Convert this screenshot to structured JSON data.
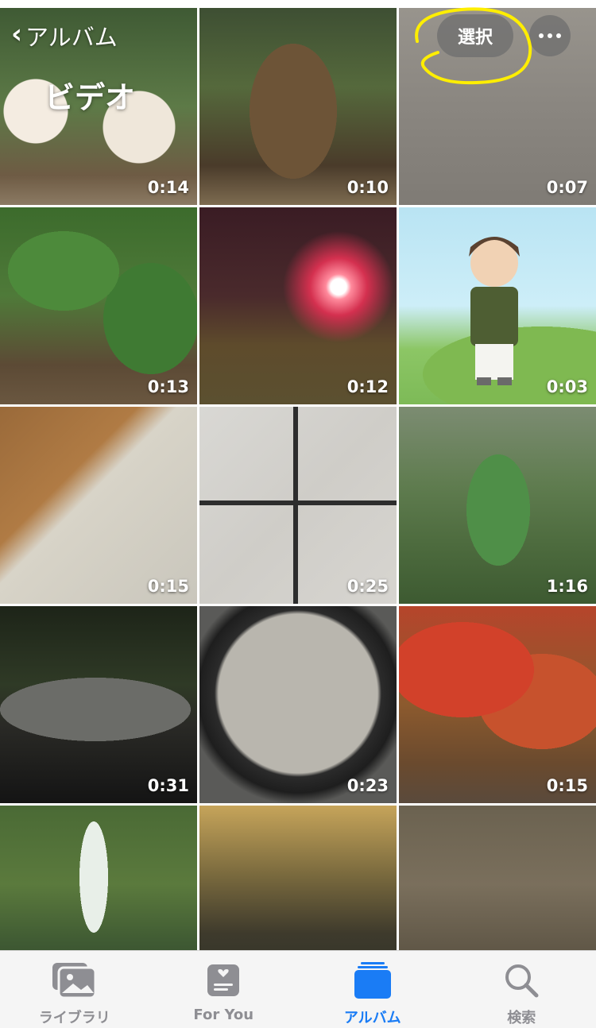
{
  "nav": {
    "back_label": "アルバム",
    "title": "ビデオ",
    "select_label": "選択",
    "more_icon": "ellipsis-icon"
  },
  "videos": [
    {
      "duration": "0:14"
    },
    {
      "duration": "0:10"
    },
    {
      "duration": "0:07"
    },
    {
      "duration": "0:13"
    },
    {
      "duration": "0:12"
    },
    {
      "duration": "0:03"
    },
    {
      "duration": "0:15"
    },
    {
      "duration": "0:25"
    },
    {
      "duration": "1:16"
    },
    {
      "duration": "0:31"
    },
    {
      "duration": "0:23"
    },
    {
      "duration": "0:15"
    },
    {
      "duration": ""
    },
    {
      "duration": ""
    },
    {
      "duration": ""
    }
  ],
  "tabbar": {
    "tabs": [
      {
        "label": "ライブラリ",
        "icon": "photos-library-icon",
        "active": false
      },
      {
        "label": "For You",
        "icon": "for-you-icon",
        "active": false
      },
      {
        "label": "アルバム",
        "icon": "albums-icon",
        "active": true
      },
      {
        "label": "検索",
        "icon": "search-icon",
        "active": false
      }
    ],
    "active_color": "#1a7cf5",
    "inactive_color": "#8e8e93"
  },
  "annotation_color": "#ffee00"
}
